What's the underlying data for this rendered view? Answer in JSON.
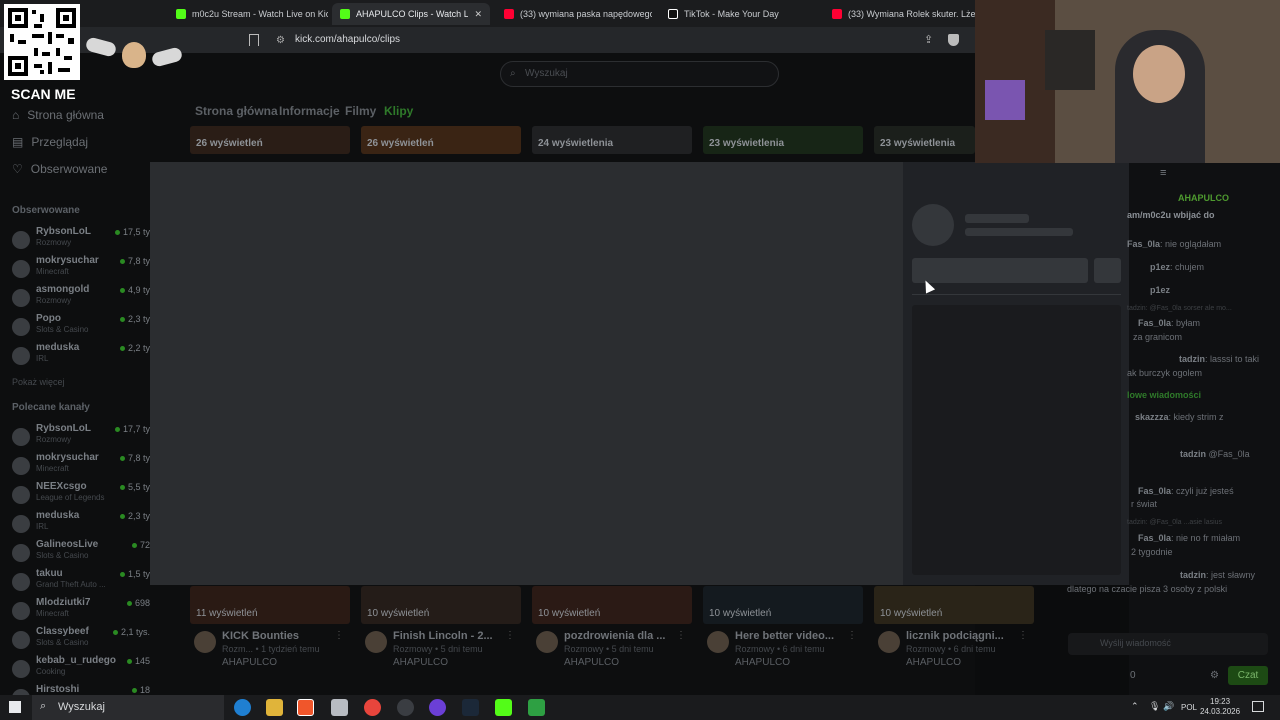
{
  "browser": {
    "tabs": [
      {
        "label": "m0c2u Stream - Watch Live on Kick",
        "color": "#53fc18"
      },
      {
        "label": "AHAPULCO Clips - Watch Live o",
        "color": "#53fc18"
      },
      {
        "label": "(33) wymiana paska napędowego sk",
        "color": "#ff0033"
      },
      {
        "label": "TikTok - Make Your Day",
        "color": "#ffffff"
      },
      {
        "label": "(33) Wymiana Rolek skuter. Lżejsze",
        "color": "#ff0033"
      }
    ],
    "close_glyph": "✕",
    "url": "kick.com/ahapulco/clips"
  },
  "overlay": {
    "scan_me": "SCAN ME"
  },
  "page": {
    "search_placeholder": "Wyszukaj",
    "nav": [
      "Strona główna",
      "Informacje",
      "Filmy",
      "Klipy"
    ],
    "sidebar": {
      "main": [
        "Strona główna",
        "Przeglądaj",
        "Obserwowane"
      ],
      "followed_heading": "Obserwowane",
      "followed": [
        {
          "name": "RybsonLoL",
          "category": "Rozmowy",
          "viewers": "17,5 ty"
        },
        {
          "name": "mokrysuchar",
          "category": "Minecraft",
          "viewers": "7,8 ty"
        },
        {
          "name": "asmongold",
          "category": "Rozmowy",
          "viewers": "4,9 ty"
        },
        {
          "name": "Popo",
          "category": "Slots & Casino",
          "viewers": "2,3 ty"
        },
        {
          "name": "meduska",
          "category": "IRL",
          "viewers": "2,2 ty"
        }
      ],
      "show_more": "Pokaż więcej",
      "recommended_heading": "Polecane kanały",
      "recommended": [
        {
          "name": "RybsonLoL",
          "category": "Rozmowy",
          "viewers": "17,7 ty"
        },
        {
          "name": "mokrysuchar",
          "category": "Minecraft",
          "viewers": "7,8 ty"
        },
        {
          "name": "NEEXcsgo",
          "category": "League of Legends",
          "viewers": "5,5 ty"
        },
        {
          "name": "meduska",
          "category": "IRL",
          "viewers": "2,3 ty"
        },
        {
          "name": "GalineosLive",
          "category": "Slots & Casino",
          "viewers": "72"
        },
        {
          "name": "takuu",
          "category": "Grand Theft Auto ...",
          "viewers": "1,5 ty"
        },
        {
          "name": "Mlodziutki7",
          "category": "Minecraft",
          "viewers": "698"
        },
        {
          "name": "Classybeef",
          "category": "Slots & Casino",
          "viewers": "2,1 tys."
        },
        {
          "name": "kebab_u_rudego",
          "category": "Cooking",
          "viewers": "145"
        },
        {
          "name": "Hirstoshi",
          "category": "",
          "viewers": "18"
        }
      ]
    },
    "clips_top": [
      "26 wyświetleń",
      "26 wyświetleń",
      "24 wyświetlenia",
      "23 wyświetlenia",
      "23 wyświetlenia"
    ],
    "clips_bottom": [
      {
        "views": "11 wyświetleń",
        "title": "KICK Bounties",
        "meta": "Rozm... • 1 tydzień temu",
        "author": "AHAPULCO"
      },
      {
        "views": "10 wyświetleń",
        "title": "Finish Lincoln - 2...",
        "meta": "Rozmowy • 5 dni temu",
        "author": "AHAPULCO"
      },
      {
        "views": "10 wyświetleń",
        "title": "pozdrowienia dla ...",
        "meta": "Rozmowy • 5 dni temu",
        "author": "AHAPULCO"
      },
      {
        "views": "10 wyświetleń",
        "title": "Here better video...",
        "meta": "Rozmowy • 6 dni temu",
        "author": "AHAPULCO"
      },
      {
        "views": "10 wyświetleń",
        "title": "licznik podciągni...",
        "meta": "Rozmowy • 6 dni temu",
        "author": "AHAPULCO"
      }
    ],
    "kebab_glyph": "⋮"
  },
  "chat": {
    "pinned_user": "AHAPULCO",
    "pinned_text": "am/m0c2u wbijać do",
    "messages": [
      {
        "user": "Fas_0la",
        "text": "nie oglądałam"
      },
      {
        "user": "p1ez",
        "text": "chujem"
      },
      {
        "user": "p1ez",
        "text": ""
      },
      {
        "user": "",
        "text": "tadzin: @Fas_0la sorser ale mo..."
      },
      {
        "user": "Fas_0la",
        "text": "byłam"
      },
      {
        "user": "",
        "text": "za granicom"
      },
      {
        "user": "tadzin",
        "text": "lasssi to taki"
      },
      {
        "user": "",
        "text": "ak burczyk ogolem"
      },
      {
        "user": "",
        "text": "lowe wiadomości"
      },
      {
        "user": "skazzza",
        "text": "kiedy strim z"
      },
      {
        "user": "tadzin",
        "text": "@Fas_0la"
      },
      {
        "user": "Fas_0la",
        "text": "czyli już jesteś"
      },
      {
        "user": "",
        "text": "r świat"
      },
      {
        "user": "",
        "text": "tadzin: @Fas_0la ...asie lasius"
      },
      {
        "user": "Fas_0la",
        "text": "nie no fr miałam"
      },
      {
        "user": "",
        "text": "2 tygodnie"
      },
      {
        "user": "tadzin",
        "text": "jest sławny"
      },
      {
        "user": "",
        "text": "dlatego na czacie pisza 3 osoby z polski"
      }
    ],
    "input_placeholder": "Wyślij wiadomość",
    "points": "0",
    "send_label": "Czat"
  },
  "taskbar": {
    "search": "Wyszukaj",
    "lang": "POL",
    "time": "19:23",
    "date": "24.03.2026"
  },
  "colors": {
    "kick_green": "#53fc18",
    "modal_bg": "#2b2d30"
  }
}
